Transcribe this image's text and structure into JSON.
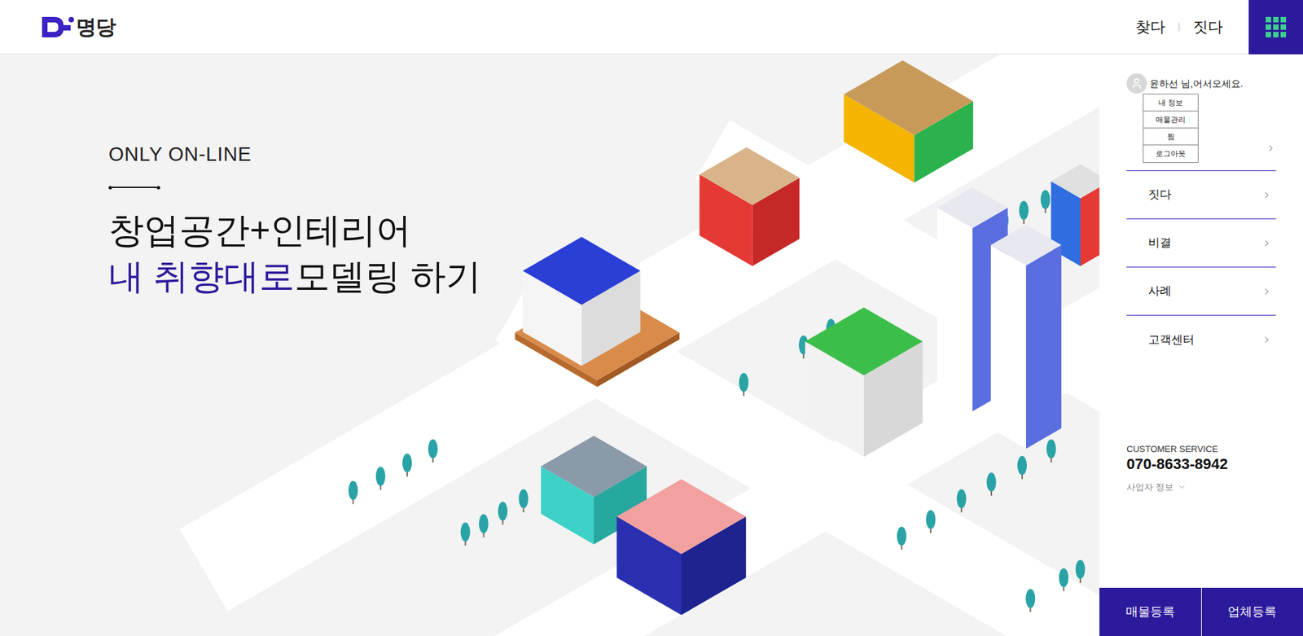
{
  "header": {
    "logo": "명당",
    "nav": [
      {
        "label": "찾다"
      },
      {
        "label": "짓다"
      }
    ]
  },
  "hero": {
    "eyebrow": "ONLY ON-LINE",
    "title_line1": "창업공간+인테리어",
    "title_highlight": "내 취향대로",
    "title_rest": "모델링 하기"
  },
  "user": {
    "greeting": "윤하선 님,어서오세요.",
    "menu": [
      "내 정보",
      "매물관리",
      "찜",
      "로그아웃"
    ]
  },
  "menu": [
    {
      "label": "짓다"
    },
    {
      "label": "비결"
    },
    {
      "label": "사례"
    },
    {
      "label": "고객센터"
    }
  ],
  "customer_service": {
    "label": "CUSTOMER SERVICE",
    "phone": "070-8633-8942",
    "business_info": "사업자 정보"
  },
  "buttons": [
    "매물등록",
    "업체등록"
  ]
}
